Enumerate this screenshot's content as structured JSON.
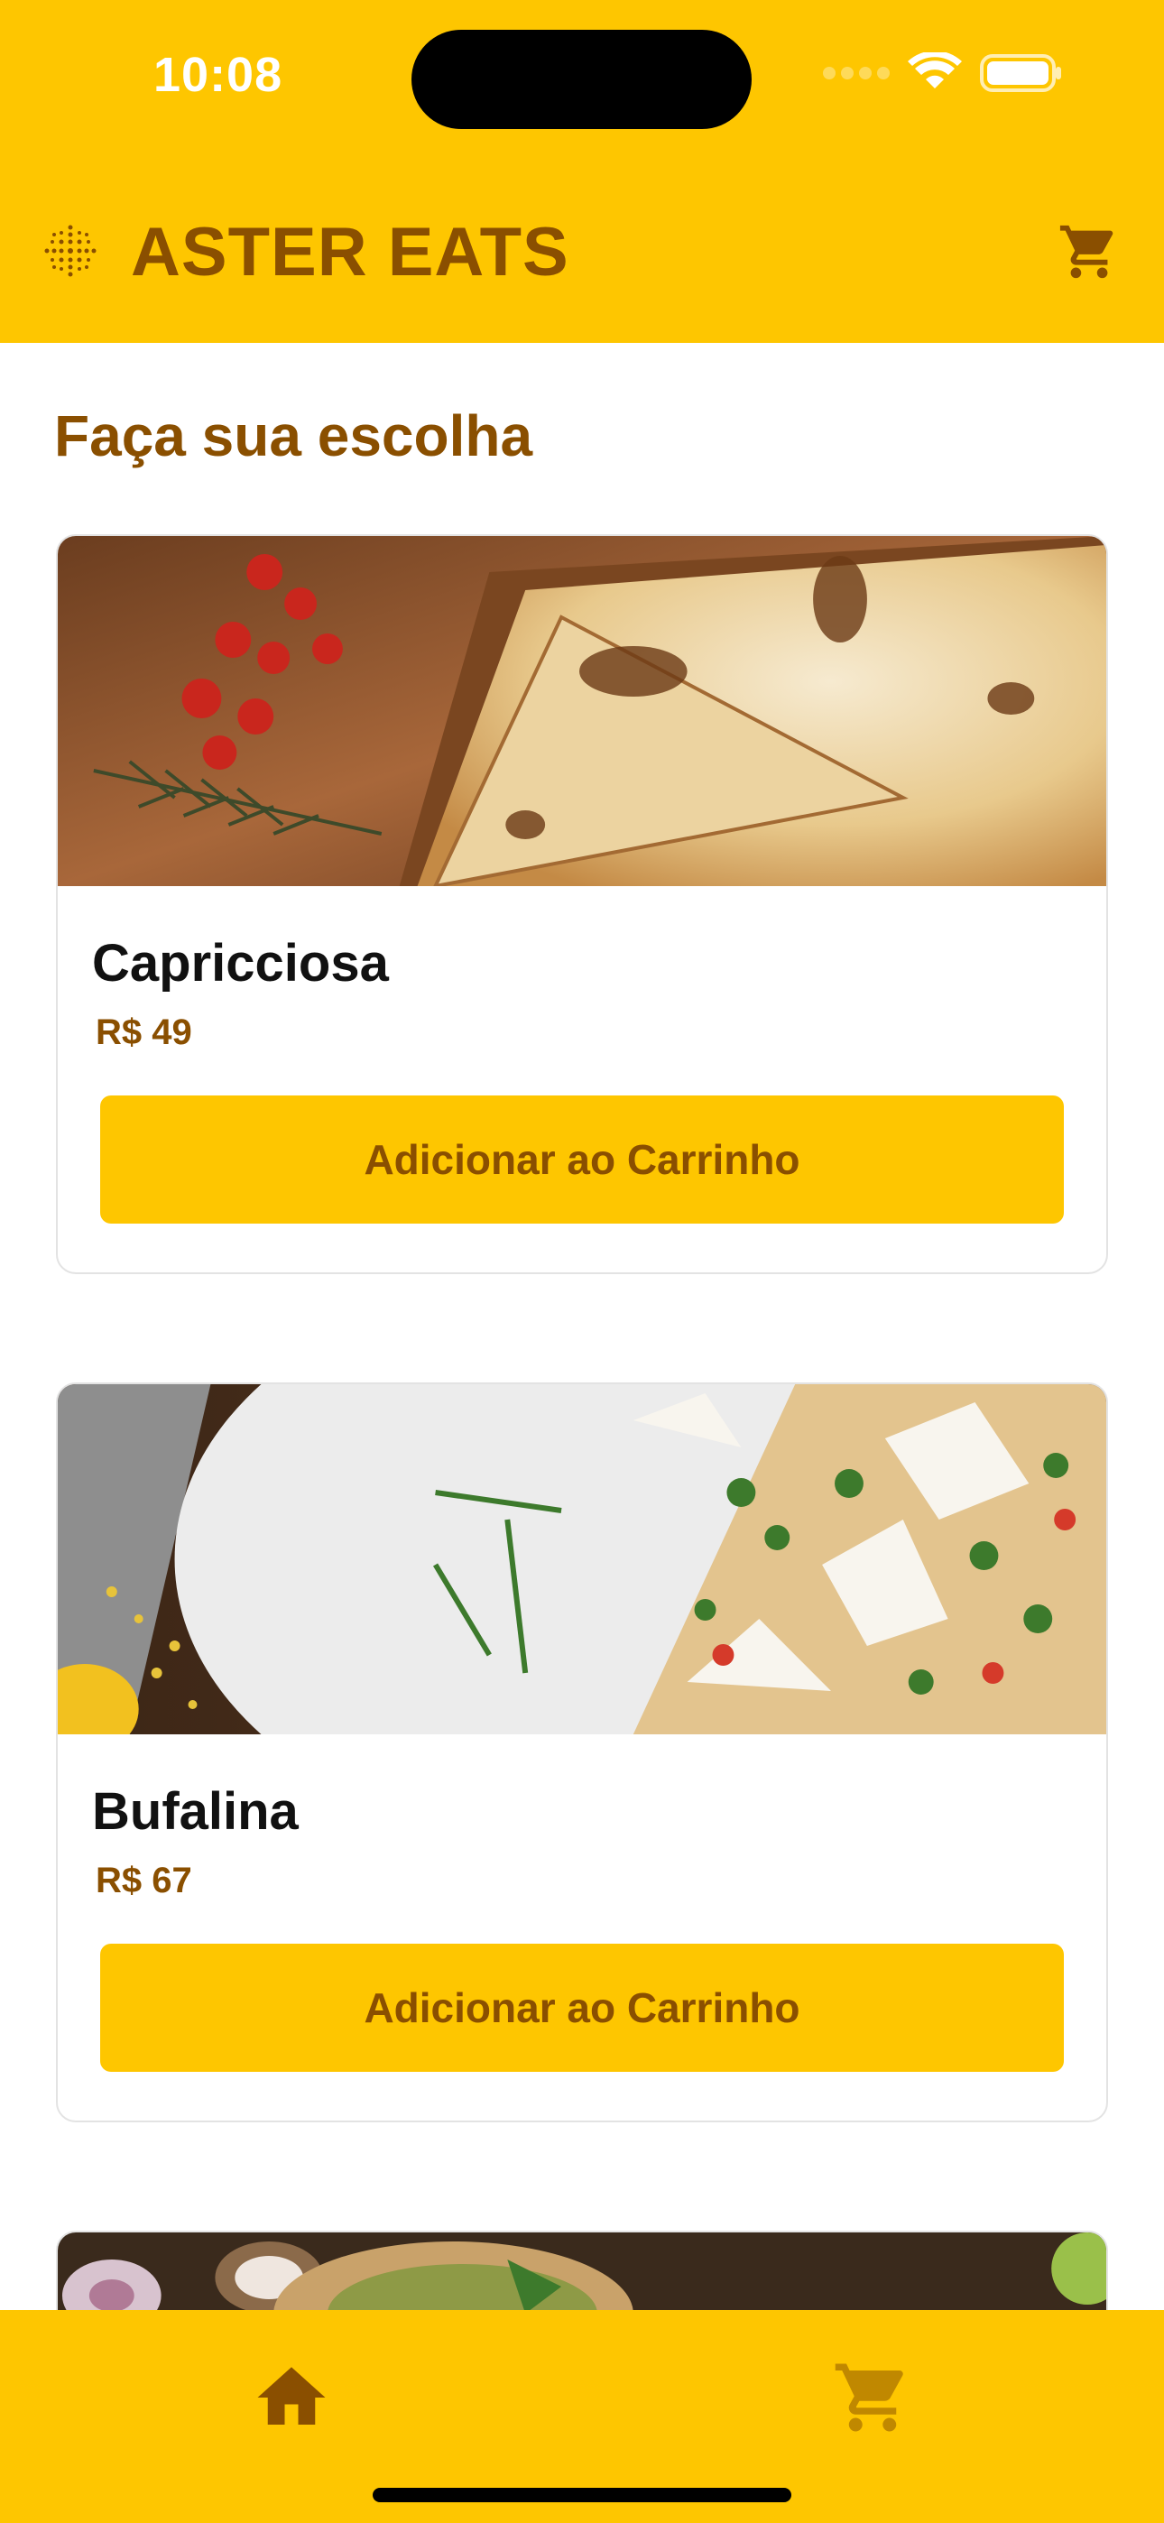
{
  "status_bar": {
    "time": "10:08"
  },
  "header": {
    "brand": "ASTER EATS",
    "brand_icon": "sparkle-dots-icon",
    "cart_icon": "shopping-cart-icon"
  },
  "main": {
    "title": "Faça sua escolha"
  },
  "products": [
    {
      "name": "Capricciosa",
      "price": "R$ 49",
      "button_label": "Adicionar ao Carrinho",
      "image": "pizza-with-tomatoes"
    },
    {
      "name": "Bufalina",
      "price": "R$ 67",
      "button_label": "Adicionar ao Carrinho",
      "image": "pizza-with-arugula"
    }
  ],
  "tabbar": {
    "items": [
      {
        "icon": "home-icon",
        "active": true
      },
      {
        "icon": "cart-icon",
        "active": false
      }
    ]
  },
  "colors": {
    "brand_yellow": "#FEC600",
    "brand_brown": "#8A4F00",
    "inactive_tab": "#C08800"
  }
}
